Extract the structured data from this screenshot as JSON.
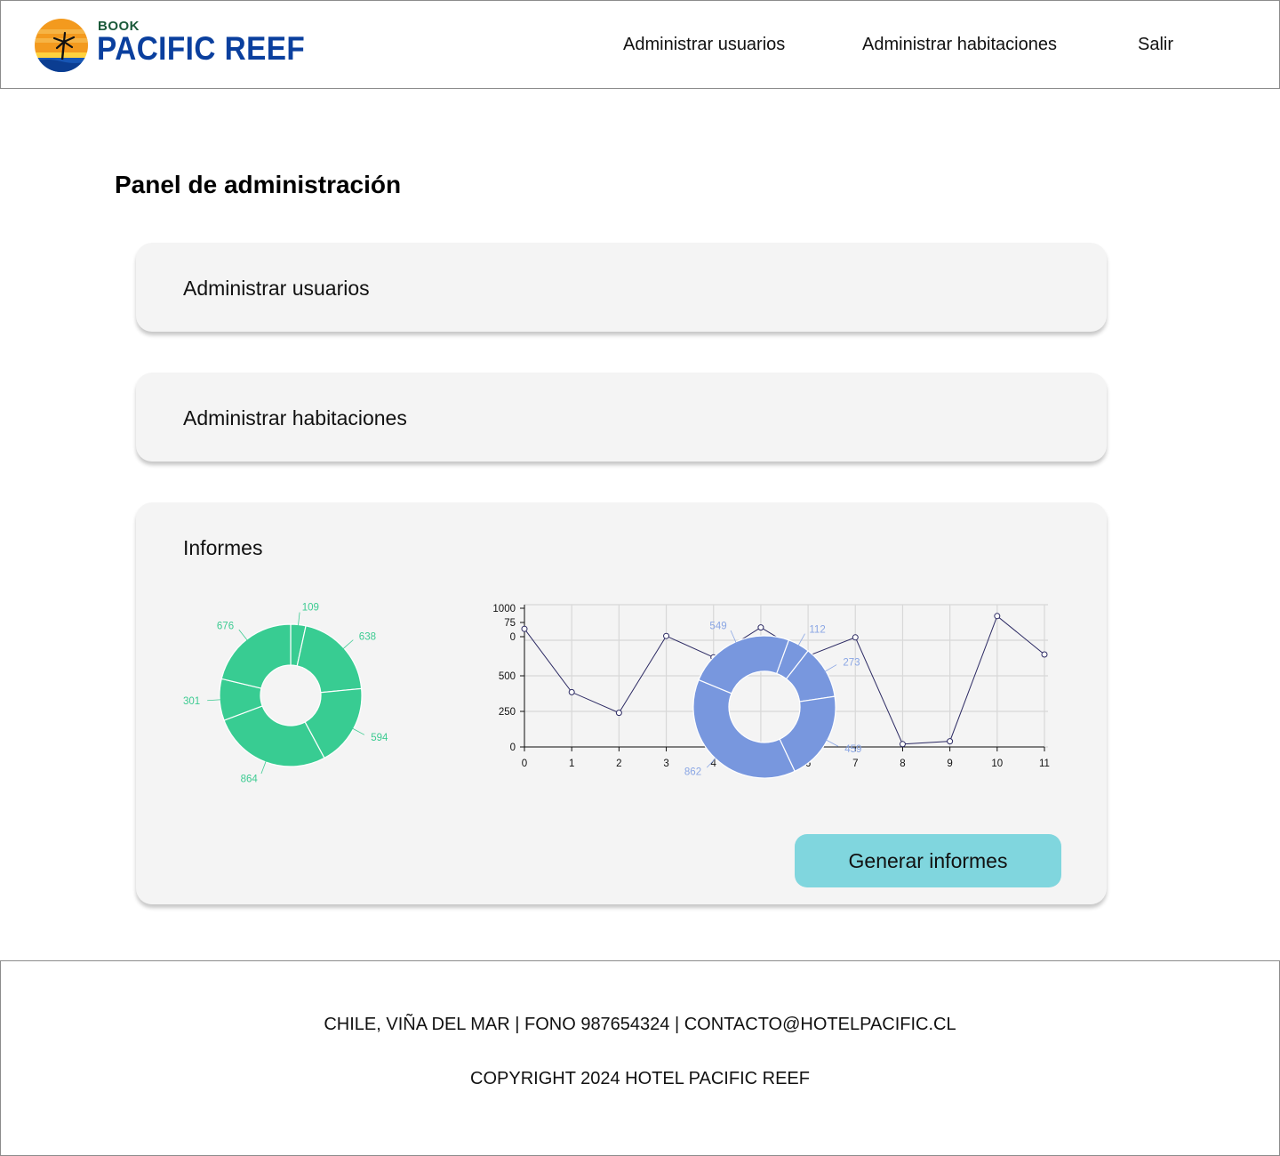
{
  "header": {
    "logo": {
      "top_text": "BOOK",
      "main_text": "PACIFIC REEF"
    },
    "nav": [
      {
        "label": "Administrar usuarios"
      },
      {
        "label": "Administrar habitaciones"
      },
      {
        "label": "Salir"
      }
    ]
  },
  "main": {
    "title": "Panel de administración",
    "cards": {
      "users": {
        "label": "Administrar usuarios"
      },
      "rooms": {
        "label": "Administrar habitaciones"
      },
      "reports": {
        "label": "Informes",
        "button_label": "Generar informes"
      }
    }
  },
  "chart_data": [
    {
      "type": "pie",
      "variant": "donut",
      "color": "#38cc92",
      "labels": [
        "109",
        "638",
        "594",
        "864",
        "301",
        "676"
      ],
      "values": [
        109,
        638,
        594,
        864,
        301,
        676
      ]
    },
    {
      "type": "line",
      "color": "#2c2a63",
      "x": [
        0,
        1,
        2,
        3,
        4,
        5,
        6,
        7,
        8,
        9,
        10,
        11
      ],
      "y": [
        830,
        385,
        240,
        780,
        630,
        840,
        640,
        770,
        20,
        40,
        920,
        650
      ],
      "y_tick_labels": [
        "0",
        "250",
        "500",
        "0",
        "75",
        "1000"
      ],
      "ylim": [
        0,
        1000
      ],
      "grid": true
    },
    {
      "type": "pie",
      "variant": "donut",
      "color": "#7897de",
      "labels": [
        "112",
        "273",
        "459",
        "862",
        "549"
      ],
      "values": [
        112,
        273,
        459,
        862,
        549
      ]
    }
  ],
  "footer": {
    "contact": "CHILE, VIÑA DEL MAR | FONO 987654324 | CONTACTO@HOTELPACIFIC.CL",
    "copyright": "COPYRIGHT 2024 HOTEL PACIFIC REEF"
  }
}
